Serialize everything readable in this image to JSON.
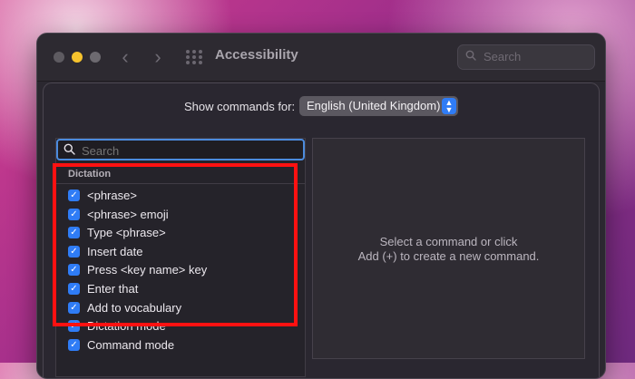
{
  "window": {
    "title": "Accessibility",
    "toolbar_search_placeholder": "Search"
  },
  "header": {
    "show_commands_label": "Show commands for:",
    "language_selected": "English (United Kingdom)"
  },
  "sidebar": {
    "search_placeholder": "Search",
    "section": "Dictation",
    "items": [
      {
        "label": "<phrase>",
        "checked": true
      },
      {
        "label": "<phrase> emoji",
        "checked": true
      },
      {
        "label": "Type <phrase>",
        "checked": true
      },
      {
        "label": "Insert date",
        "checked": true
      },
      {
        "label": "Press <key name> key",
        "checked": true
      },
      {
        "label": "Enter that",
        "checked": true
      },
      {
        "label": "Add to vocabulary",
        "checked": true
      },
      {
        "label": "Dictation mode",
        "checked": true
      },
      {
        "label": "Command mode",
        "checked": true
      }
    ]
  },
  "detail": {
    "empty_line1": "Select a command or click",
    "empty_line2": "Add (+) to create a new command."
  },
  "colors": {
    "accent": "#2f7cf6",
    "highlight": "#ff1111"
  },
  "icons": {
    "nav_back": "chevron-left-icon",
    "nav_forward": "chevron-right-icon",
    "grid": "grid-icon",
    "search": "search-icon",
    "checkbox": "checkmark-icon"
  }
}
